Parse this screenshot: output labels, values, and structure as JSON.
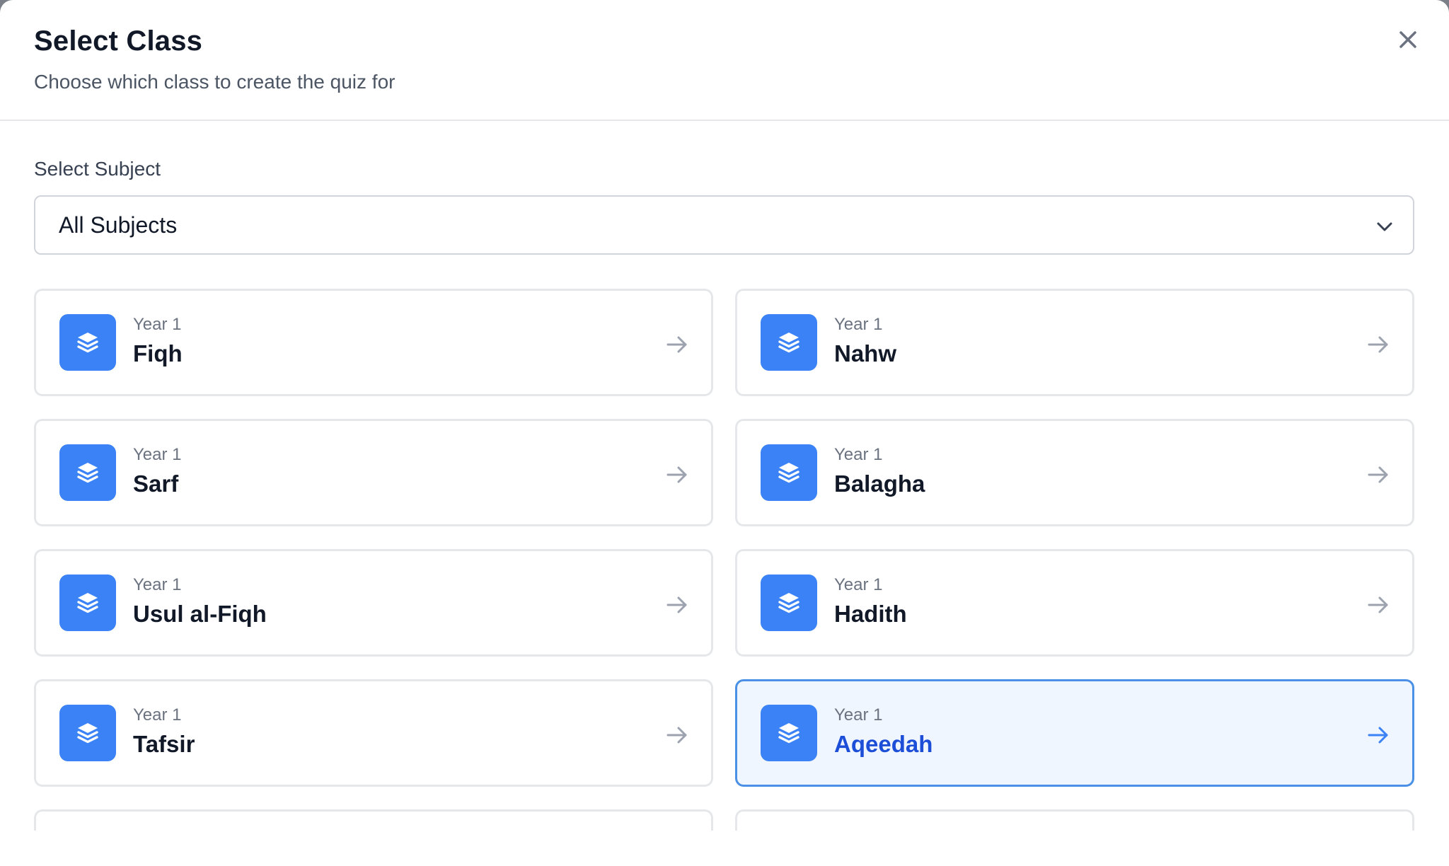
{
  "modal": {
    "title": "Select Class",
    "subtitle": "Choose which class to create the quiz for"
  },
  "subject_filter": {
    "label": "Select Subject",
    "selected": "All Subjects"
  },
  "classes": [
    {
      "year": "Year 1",
      "name": "Fiqh",
      "selected": false
    },
    {
      "year": "Year 1",
      "name": "Nahw",
      "selected": false
    },
    {
      "year": "Year 1",
      "name": "Sarf",
      "selected": false
    },
    {
      "year": "Year 1",
      "name": "Balagha",
      "selected": false
    },
    {
      "year": "Year 1",
      "name": "Usul al-Fiqh",
      "selected": false
    },
    {
      "year": "Year 1",
      "name": "Hadith",
      "selected": false
    },
    {
      "year": "Year 1",
      "name": "Tafsir",
      "selected": false
    },
    {
      "year": "Year 1",
      "name": "Aqeedah",
      "selected": true
    }
  ],
  "icons": {
    "close": "close-icon",
    "dropdown": "chevron-down-icon",
    "class": "layers-icon",
    "go": "arrow-right-icon"
  },
  "colors": {
    "accent": "#3b82f6",
    "selected_border": "#4a90e6",
    "selected_bg": "#eff6ff",
    "selected_text": "#1d4ed8"
  }
}
